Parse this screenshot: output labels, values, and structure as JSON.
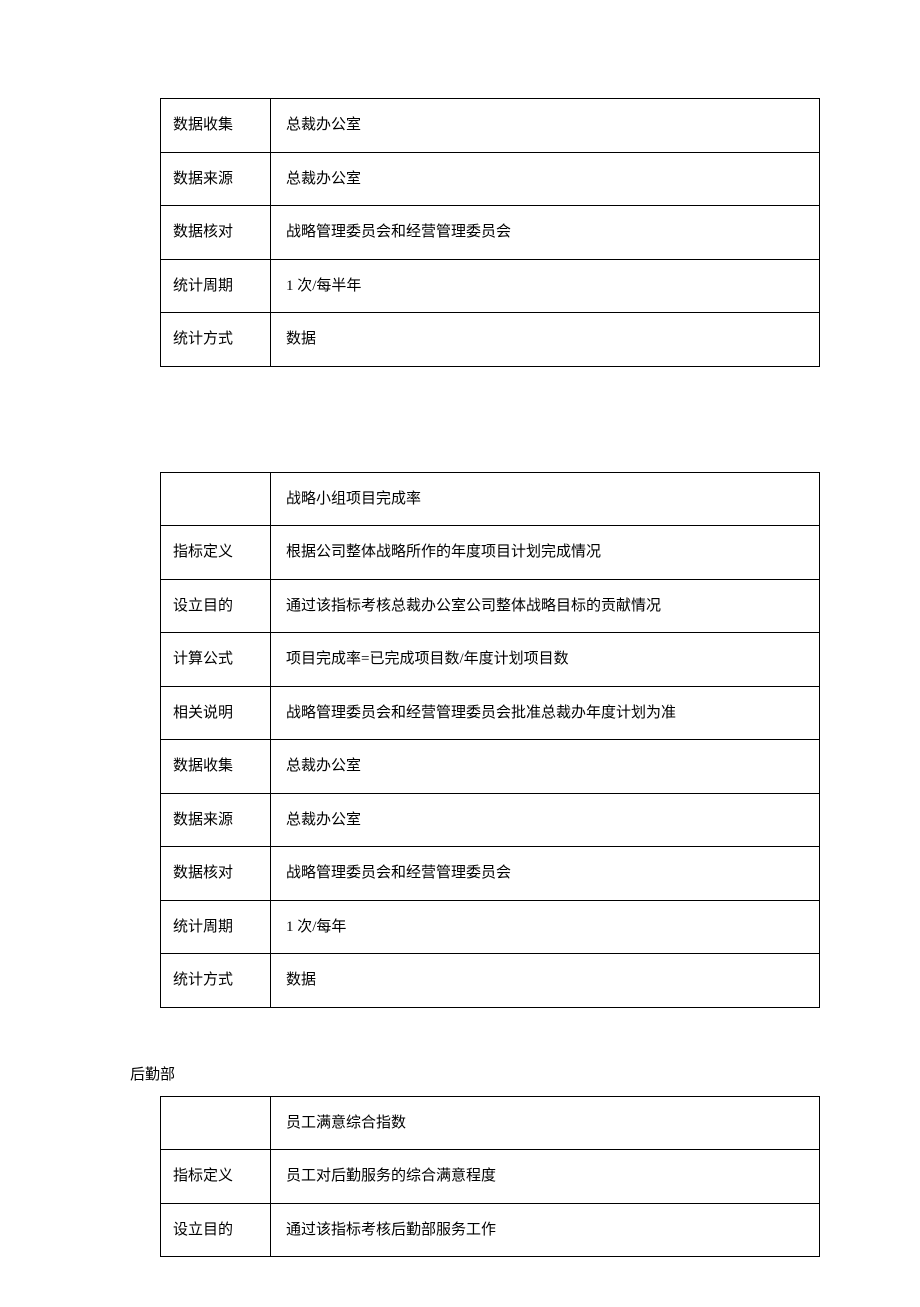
{
  "table1": {
    "rows": [
      {
        "label": "数据收集",
        "value": "总裁办公室"
      },
      {
        "label": "数据来源",
        "value": "总裁办公室"
      },
      {
        "label": "数据核对",
        "value": "战略管理委员会和经营管理委员会"
      },
      {
        "label": "统计周期",
        "value": "1 次/每半年"
      },
      {
        "label": "统计方式",
        "value": "数据"
      }
    ]
  },
  "table2": {
    "rows": [
      {
        "label": "",
        "value": "战略小组项目完成率"
      },
      {
        "label": "指标定义",
        "value": "根据公司整体战略所作的年度项目计划完成情况"
      },
      {
        "label": "设立目的",
        "value": "通过该指标考核总裁办公室公司整体战略目标的贡献情况"
      },
      {
        "label": "计算公式",
        "value": "项目完成率=已完成项目数/年度计划项目数"
      },
      {
        "label": "相关说明",
        "value": "战略管理委员会和经营管理委员会批准总裁办年度计划为准"
      },
      {
        "label": "数据收集",
        "value": "总裁办公室"
      },
      {
        "label": "数据来源",
        "value": "总裁办公室"
      },
      {
        "label": "数据核对",
        "value": "战略管理委员会和经营管理委员会"
      },
      {
        "label": "统计周期",
        "value": "1 次/每年"
      },
      {
        "label": "统计方式",
        "value": "数据"
      }
    ]
  },
  "section_heading": "后勤部",
  "table3": {
    "rows": [
      {
        "label": "",
        "value": "员工满意综合指数"
      },
      {
        "label": "指标定义",
        "value": "员工对后勤服务的综合满意程度"
      },
      {
        "label": "设立目的",
        "value": "通过该指标考核后勤部服务工作"
      }
    ]
  }
}
